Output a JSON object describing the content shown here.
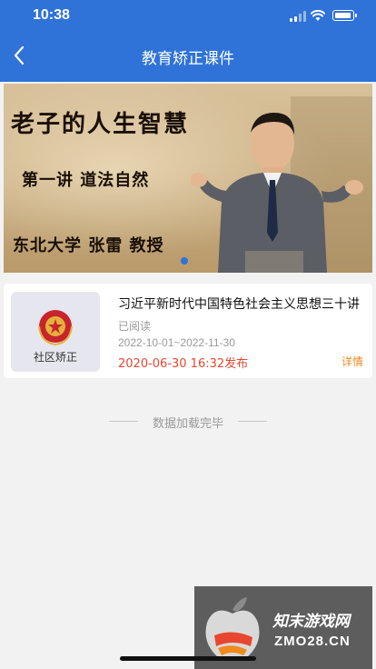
{
  "status_bar": {
    "time": "10:38"
  },
  "header": {
    "title": "教育矫正课件"
  },
  "banner": {
    "line1": "老子的人生智慧",
    "line2": "第一讲  道法自然",
    "line3": "东北大学 张雷 教授",
    "active_slide": 1
  },
  "courses": [
    {
      "title": "习近平新时代中国特色社会主义思想三十讲",
      "read_status": "已阅读",
      "period": "2022-10-01~2022-11-30",
      "published": "2020-06-30 16:32发布",
      "detail_label": "详情",
      "thumb_label": "社区矫正"
    }
  ],
  "list_end_text": "数据加载完毕",
  "watermark": {
    "text": "知末游戏网",
    "url": "ZMO28.CN"
  },
  "colors": {
    "primary": "#2f73d8",
    "publish_red": "#e8462f",
    "detail_orange": "#f08a1d"
  }
}
